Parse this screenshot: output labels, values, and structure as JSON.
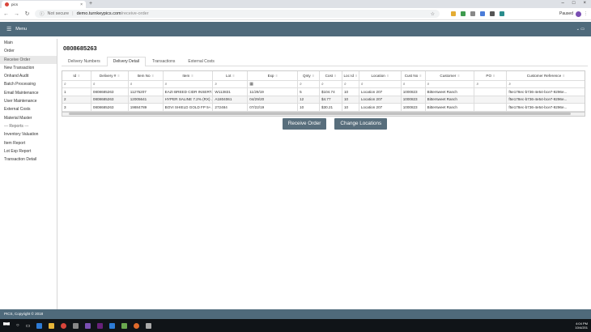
{
  "browser": {
    "tab_title": "pics",
    "secure_label": "Not secure",
    "url_host": "demo.turnkeypics.com",
    "url_path": "/receive-order",
    "profile_label": "Paused"
  },
  "appbar": {
    "menu_label": "Menu"
  },
  "sidebar": {
    "items": [
      {
        "label": "Main"
      },
      {
        "label": "Order"
      },
      {
        "label": "Receive Order"
      },
      {
        "label": "New Transaction"
      },
      {
        "label": "Onhand Audit"
      },
      {
        "label": "Batch Processing"
      },
      {
        "label": "Email Maintenance"
      },
      {
        "label": "User Maintenance"
      },
      {
        "label": "External Costs"
      },
      {
        "label": "Material Master"
      },
      {
        "label": "--- Reports ---"
      },
      {
        "label": "Inventory Valuation"
      },
      {
        "label": "Item Report"
      },
      {
        "label": "Lot Exp Report"
      },
      {
        "label": "Transaction Detail"
      }
    ],
    "active_index": 2
  },
  "order": {
    "number": "0808685263",
    "tabs": [
      "Delivery Numbers",
      "Delivery Detail",
      "Transactions",
      "External Costs"
    ],
    "active_tab": 1
  },
  "grid": {
    "columns": [
      "Id",
      "Delivery #",
      "Item No",
      "Item",
      "Lot",
      "Exp",
      "Qnty",
      "Cost",
      "Loc Id",
      "Location",
      "Cust No",
      "Customer",
      "PO",
      "Customer Reference"
    ],
    "rows": [
      [
        "1",
        "0808685263",
        "11275207",
        "EAZI BREED CIDR INSERT...",
        "W113831",
        "11/29/19",
        "5",
        "$104.74",
        "10",
        "Location 207",
        "1000823",
        "Bittersweet Ranch",
        "",
        "f5e178ec-b736-4e54-bce7-9296e..."
      ],
      [
        "2",
        "0808685263",
        "12005641",
        "HYPER SALINE 7.2% (RX) ...",
        "A1804061",
        "04/29/20",
        "12",
        "$4.77",
        "10",
        "Location 207",
        "1000823",
        "Bittersweet Ranch",
        "",
        "f5e178ec-b736-4e54-bce7-9296e..."
      ],
      [
        "3",
        "0808685263",
        "19884789",
        "BOVI SHIELD GOLD FP 5+...",
        "272484",
        "07/22/19",
        "10",
        "$30.21",
        "10",
        "Location 207",
        "1000823",
        "Bittersweet Ranch",
        "",
        "f5e178ec-b736-4e54-bce7-9296e..."
      ]
    ]
  },
  "actions": {
    "receive_label": "Receive Order",
    "change_label": "Change Locations"
  },
  "footer": {
    "text": "PICS, Copyright © 2018"
  },
  "taskbar": {
    "time": "4:04 PM",
    "date": "10/4/201"
  }
}
